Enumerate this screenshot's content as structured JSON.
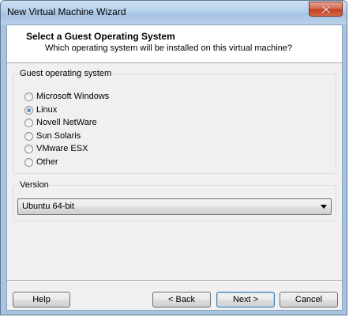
{
  "window": {
    "title": "New Virtual Machine Wizard"
  },
  "header": {
    "title": "Select a Guest Operating System",
    "subtitle": "Which operating system will be installed on this virtual machine?"
  },
  "guest_os": {
    "label": "Guest operating system",
    "options": [
      "Microsoft Windows",
      "Linux",
      "Novell NetWare",
      "Sun Solaris",
      "VMware ESX",
      "Other"
    ],
    "selected": "Linux"
  },
  "version": {
    "label": "Version",
    "selected": "Ubuntu 64-bit"
  },
  "buttons": {
    "help": "Help",
    "back": "< Back",
    "next": "Next >",
    "cancel": "Cancel"
  }
}
